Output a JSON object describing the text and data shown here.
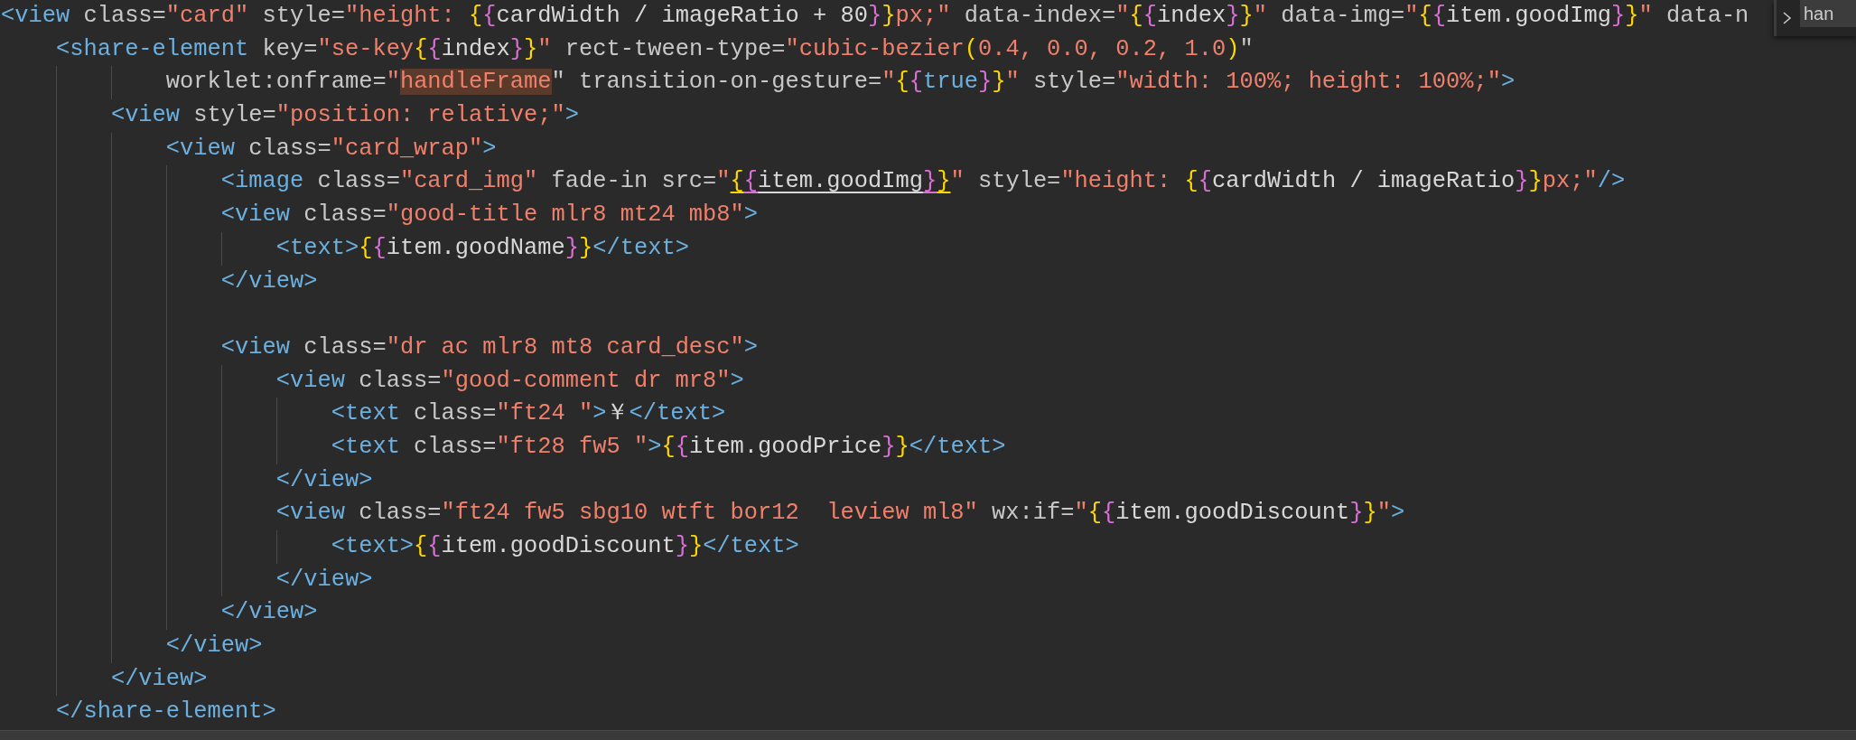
{
  "editor": {
    "lines": [
      {
        "tokens": [
          {
            "kind": "tag",
            "text": "<view"
          },
          {
            "kind": "attr",
            "text": " class="
          },
          {
            "kind": "str",
            "text": "\"card\""
          },
          {
            "kind": "attr",
            "text": " style="
          },
          {
            "kind": "str",
            "text": "\"height: "
          },
          {
            "kind": "b1",
            "text": "{"
          },
          {
            "kind": "b2",
            "text": "{"
          },
          {
            "kind": "text",
            "text": "cardWidth / imageRatio + 80"
          },
          {
            "kind": "b2",
            "text": "}"
          },
          {
            "kind": "b1",
            "text": "}"
          },
          {
            "kind": "str",
            "text": "px;\""
          },
          {
            "kind": "attr",
            "text": " data-index="
          },
          {
            "kind": "str",
            "text": "\""
          },
          {
            "kind": "b1",
            "text": "{"
          },
          {
            "kind": "b2",
            "text": "{"
          },
          {
            "kind": "text",
            "text": "index"
          },
          {
            "kind": "b2",
            "text": "}"
          },
          {
            "kind": "b1",
            "text": "}"
          },
          {
            "kind": "str",
            "text": "\""
          },
          {
            "kind": "attr",
            "text": " data-img="
          },
          {
            "kind": "str",
            "text": "\""
          },
          {
            "kind": "b1",
            "text": "{"
          },
          {
            "kind": "b2",
            "text": "{"
          },
          {
            "kind": "text",
            "text": "item.goodImg"
          },
          {
            "kind": "b2",
            "text": "}"
          },
          {
            "kind": "b1",
            "text": "}"
          },
          {
            "kind": "str",
            "text": "\""
          },
          {
            "kind": "attr",
            "text": " data-n"
          }
        ]
      },
      {
        "tokens": [
          {
            "kind": "tag",
            "text": "    <share-element"
          },
          {
            "kind": "attr",
            "text": " key="
          },
          {
            "kind": "str",
            "text": "\"se-key"
          },
          {
            "kind": "b1",
            "text": "{"
          },
          {
            "kind": "b2",
            "text": "{"
          },
          {
            "kind": "text",
            "text": "index"
          },
          {
            "kind": "b2",
            "text": "}"
          },
          {
            "kind": "b1",
            "text": "}"
          },
          {
            "kind": "str",
            "text": "\""
          },
          {
            "kind": "attr",
            "text": " rect-tween-type="
          },
          {
            "kind": "str",
            "text": "\"cubic-bezier"
          },
          {
            "kind": "b1",
            "text": "("
          },
          {
            "kind": "str",
            "text": "0.4, 0.0, 0.2, 1.0"
          },
          {
            "kind": "b1",
            "text": ")"
          },
          {
            "kind": "attr",
            "text": "\""
          }
        ]
      },
      {
        "tokens": [
          {
            "kind": "attr",
            "text": "            worklet:onframe="
          },
          {
            "kind": "str",
            "text": "\""
          },
          {
            "kind": "hl",
            "text": "handleFrame"
          },
          {
            "kind": "attr",
            "text": "\" transition-on-gesture="
          },
          {
            "kind": "str",
            "text": "\""
          },
          {
            "kind": "b1",
            "text": "{"
          },
          {
            "kind": "b2",
            "text": "{"
          },
          {
            "kind": "kw",
            "text": "true"
          },
          {
            "kind": "b2",
            "text": "}"
          },
          {
            "kind": "b1",
            "text": "}"
          },
          {
            "kind": "str",
            "text": "\""
          },
          {
            "kind": "attr",
            "text": " style="
          },
          {
            "kind": "str",
            "text": "\"width: 100%; height: 100%;\""
          },
          {
            "kind": "tag",
            "text": ">"
          }
        ]
      },
      {
        "tokens": [
          {
            "kind": "tag",
            "text": "        <view"
          },
          {
            "kind": "attr",
            "text": " style="
          },
          {
            "kind": "str",
            "text": "\"position: relative;\""
          },
          {
            "kind": "tag",
            "text": ">"
          }
        ]
      },
      {
        "tokens": [
          {
            "kind": "tag",
            "text": "            <view"
          },
          {
            "kind": "attr",
            "text": " class="
          },
          {
            "kind": "str",
            "text": "\"card_wrap\""
          },
          {
            "kind": "tag",
            "text": ">"
          }
        ]
      },
      {
        "tokens": [
          {
            "kind": "tag",
            "text": "                <image"
          },
          {
            "kind": "attr",
            "text": " class="
          },
          {
            "kind": "str",
            "text": "\"card_img\""
          },
          {
            "kind": "attr",
            "text": " fade-in src="
          },
          {
            "kind": "str",
            "text": "\""
          },
          {
            "kind": "b1u",
            "text": "{"
          },
          {
            "kind": "b2u",
            "text": "{"
          },
          {
            "kind": "textu",
            "text": "item.goodImg"
          },
          {
            "kind": "b2u",
            "text": "}"
          },
          {
            "kind": "b1u",
            "text": "}"
          },
          {
            "kind": "str",
            "text": "\""
          },
          {
            "kind": "attr",
            "text": " style="
          },
          {
            "kind": "str",
            "text": "\"height: "
          },
          {
            "kind": "b1",
            "text": "{"
          },
          {
            "kind": "b2",
            "text": "{"
          },
          {
            "kind": "text",
            "text": "cardWidth / imageRatio"
          },
          {
            "kind": "b2",
            "text": "}"
          },
          {
            "kind": "b1",
            "text": "}"
          },
          {
            "kind": "str",
            "text": "px;\""
          },
          {
            "kind": "tag",
            "text": "/>"
          }
        ]
      },
      {
        "tokens": [
          {
            "kind": "tag",
            "text": "                <view"
          },
          {
            "kind": "attr",
            "text": " class="
          },
          {
            "kind": "str",
            "text": "\"good-title mlr8 mt24 mb8\""
          },
          {
            "kind": "tag",
            "text": ">"
          }
        ]
      },
      {
        "tokens": [
          {
            "kind": "tag",
            "text": "                    <text>"
          },
          {
            "kind": "b1",
            "text": "{"
          },
          {
            "kind": "b2",
            "text": "{"
          },
          {
            "kind": "text",
            "text": "item.goodName"
          },
          {
            "kind": "b2",
            "text": "}"
          },
          {
            "kind": "b1",
            "text": "}"
          },
          {
            "kind": "tag",
            "text": "</text>"
          }
        ]
      },
      {
        "tokens": [
          {
            "kind": "tag",
            "text": "                </view>"
          }
        ]
      },
      {
        "kind": "blank"
      },
      {
        "tokens": [
          {
            "kind": "tag",
            "text": "                <view"
          },
          {
            "kind": "attr",
            "text": " class="
          },
          {
            "kind": "str",
            "text": "\"dr ac mlr8 mt8 card_desc\""
          },
          {
            "kind": "tag",
            "text": ">"
          }
        ]
      },
      {
        "tokens": [
          {
            "kind": "tag",
            "text": "                    <view"
          },
          {
            "kind": "attr",
            "text": " class="
          },
          {
            "kind": "str",
            "text": "\"good-comment dr mr8\""
          },
          {
            "kind": "tag",
            "text": ">"
          }
        ]
      },
      {
        "tokens": [
          {
            "kind": "tag",
            "text": "                        <text"
          },
          {
            "kind": "attr",
            "text": " class="
          },
          {
            "kind": "str",
            "text": "\"ft24 \""
          },
          {
            "kind": "tag",
            "text": ">"
          },
          {
            "kind": "text",
            "text": "￥"
          },
          {
            "kind": "tag",
            "text": "</text>"
          }
        ]
      },
      {
        "tokens": [
          {
            "kind": "tag",
            "text": "                        <text"
          },
          {
            "kind": "attr",
            "text": " class="
          },
          {
            "kind": "str",
            "text": "\"ft28 fw5 \""
          },
          {
            "kind": "tag",
            "text": ">"
          },
          {
            "kind": "b1",
            "text": "{"
          },
          {
            "kind": "b2",
            "text": "{"
          },
          {
            "kind": "text",
            "text": "item.goodPrice"
          },
          {
            "kind": "b2",
            "text": "}"
          },
          {
            "kind": "b1",
            "text": "}"
          },
          {
            "kind": "tag",
            "text": "</text>"
          }
        ]
      },
      {
        "tokens": [
          {
            "kind": "tag",
            "text": "                    </view>"
          }
        ]
      },
      {
        "tokens": [
          {
            "kind": "tag",
            "text": "                    <view"
          },
          {
            "kind": "attr",
            "text": " class="
          },
          {
            "kind": "str",
            "text": "\"ft24 fw5 sbg10 wtft bor12  leview ml8\""
          },
          {
            "kind": "attr",
            "text": " wx:if="
          },
          {
            "kind": "str",
            "text": "\""
          },
          {
            "kind": "b1",
            "text": "{"
          },
          {
            "kind": "b2",
            "text": "{"
          },
          {
            "kind": "text",
            "text": "item.goodDiscount"
          },
          {
            "kind": "b2",
            "text": "}"
          },
          {
            "kind": "b1",
            "text": "}"
          },
          {
            "kind": "str",
            "text": "\""
          },
          {
            "kind": "tag",
            "text": ">"
          }
        ]
      },
      {
        "tokens": [
          {
            "kind": "tag",
            "text": "                        <text>"
          },
          {
            "kind": "b1",
            "text": "{"
          },
          {
            "kind": "b2",
            "text": "{"
          },
          {
            "kind": "text",
            "text": "item.goodDiscount"
          },
          {
            "kind": "b2",
            "text": "}"
          },
          {
            "kind": "b1",
            "text": "}"
          },
          {
            "kind": "tag",
            "text": "</text>"
          }
        ]
      },
      {
        "tokens": [
          {
            "kind": "tag",
            "text": "                    </view>"
          }
        ]
      },
      {
        "tokens": [
          {
            "kind": "tag",
            "text": "                </view>"
          }
        ]
      },
      {
        "tokens": [
          {
            "kind": "tag",
            "text": "            </view>"
          }
        ]
      },
      {
        "tokens": [
          {
            "kind": "tag",
            "text": "        </view>"
          }
        ]
      },
      {
        "tokens": [
          {
            "kind": "tag",
            "text": "    </share-element>"
          }
        ]
      }
    ]
  },
  "find_widget": {
    "query": "han"
  }
}
